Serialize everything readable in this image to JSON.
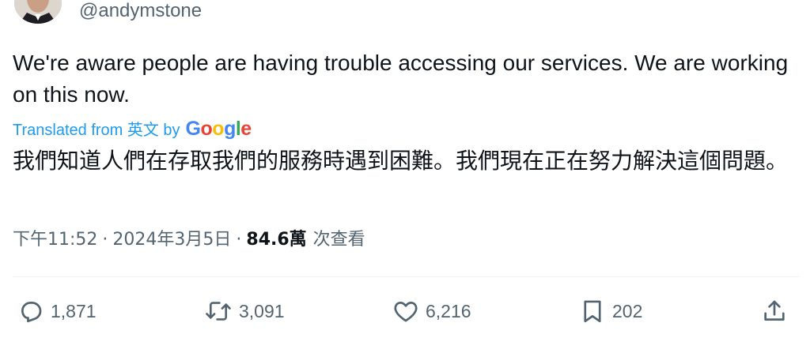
{
  "author": {
    "handle": "@andymstone"
  },
  "tweet": {
    "text": "We're aware people are having trouble accessing our services. We are working on this now.",
    "translation_label": "Translated from 英文 by",
    "translation_provider": "Google",
    "translated_text": "我們知道人們在存取我們的服務時遇到困難。我們現在正在努力解決這個問題。"
  },
  "meta": {
    "time": "下午11:52",
    "date": "2024年3月5日",
    "separator": "·",
    "views_count": "84.6萬",
    "views_label": "次查看"
  },
  "actions": {
    "replies": "1,871",
    "reposts": "3,091",
    "likes": "6,216",
    "bookmarks": "202"
  },
  "colors": {
    "text": "#0f1419",
    "secondary": "#536471",
    "link": "#1d9bf0",
    "google_blue": "#4285f4",
    "google_red": "#ea4335",
    "google_yellow": "#fbbc05",
    "google_green": "#34a853"
  }
}
